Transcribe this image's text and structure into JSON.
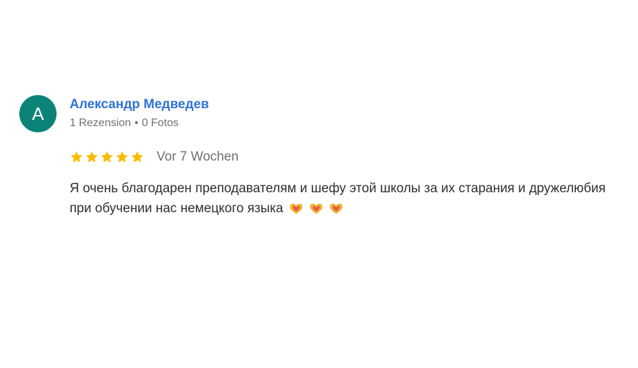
{
  "review": {
    "avatar_letter": "A",
    "author_name": "Александр Медведев",
    "review_count": "1 Rezension",
    "separator": "•",
    "photo_count": "0 Fotos",
    "rating": 5,
    "rating_max": 5,
    "date": "Vor 7 Wochen",
    "text": "Я очень благодарен преподавателям и шефу этой школы за их старания и дружелюбия при обучении нас немецкого языка",
    "emoji": [
      "heart-hands-icon",
      "heart-hands-icon",
      "heart-hands-icon"
    ],
    "colors": {
      "avatar_bg": "#0b8377",
      "name": "#2f73d6",
      "star": "#fbbc04",
      "meta": "#6f6f6f",
      "text": "#2f2f2f"
    }
  }
}
